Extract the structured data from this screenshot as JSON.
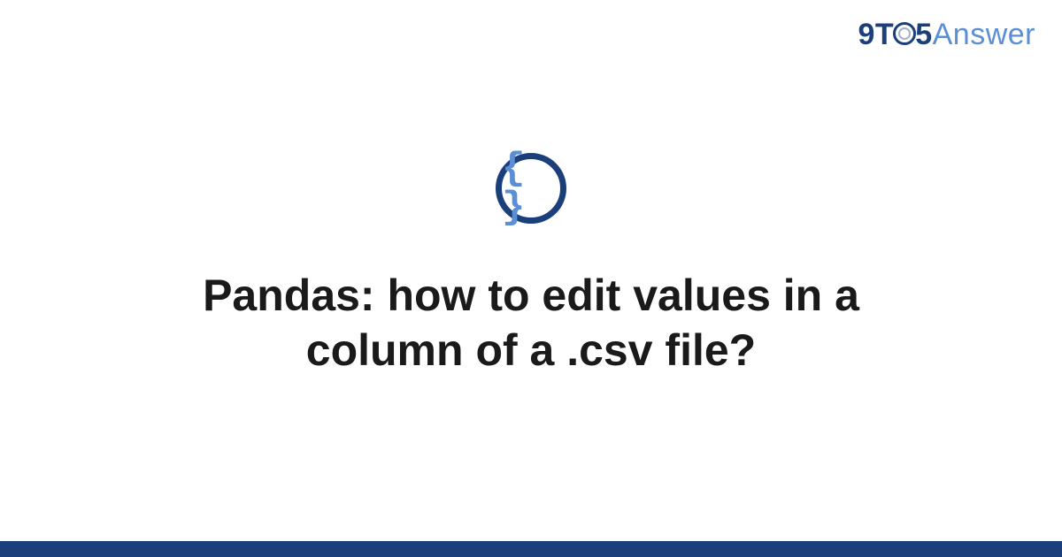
{
  "logo": {
    "part1": "9",
    "part2": "T",
    "part3": "5",
    "part4": "Answer"
  },
  "icon": {
    "name": "braces-icon",
    "glyph": "{ }"
  },
  "title": "Pandas: how to edit values in a column of a .csv file?"
}
